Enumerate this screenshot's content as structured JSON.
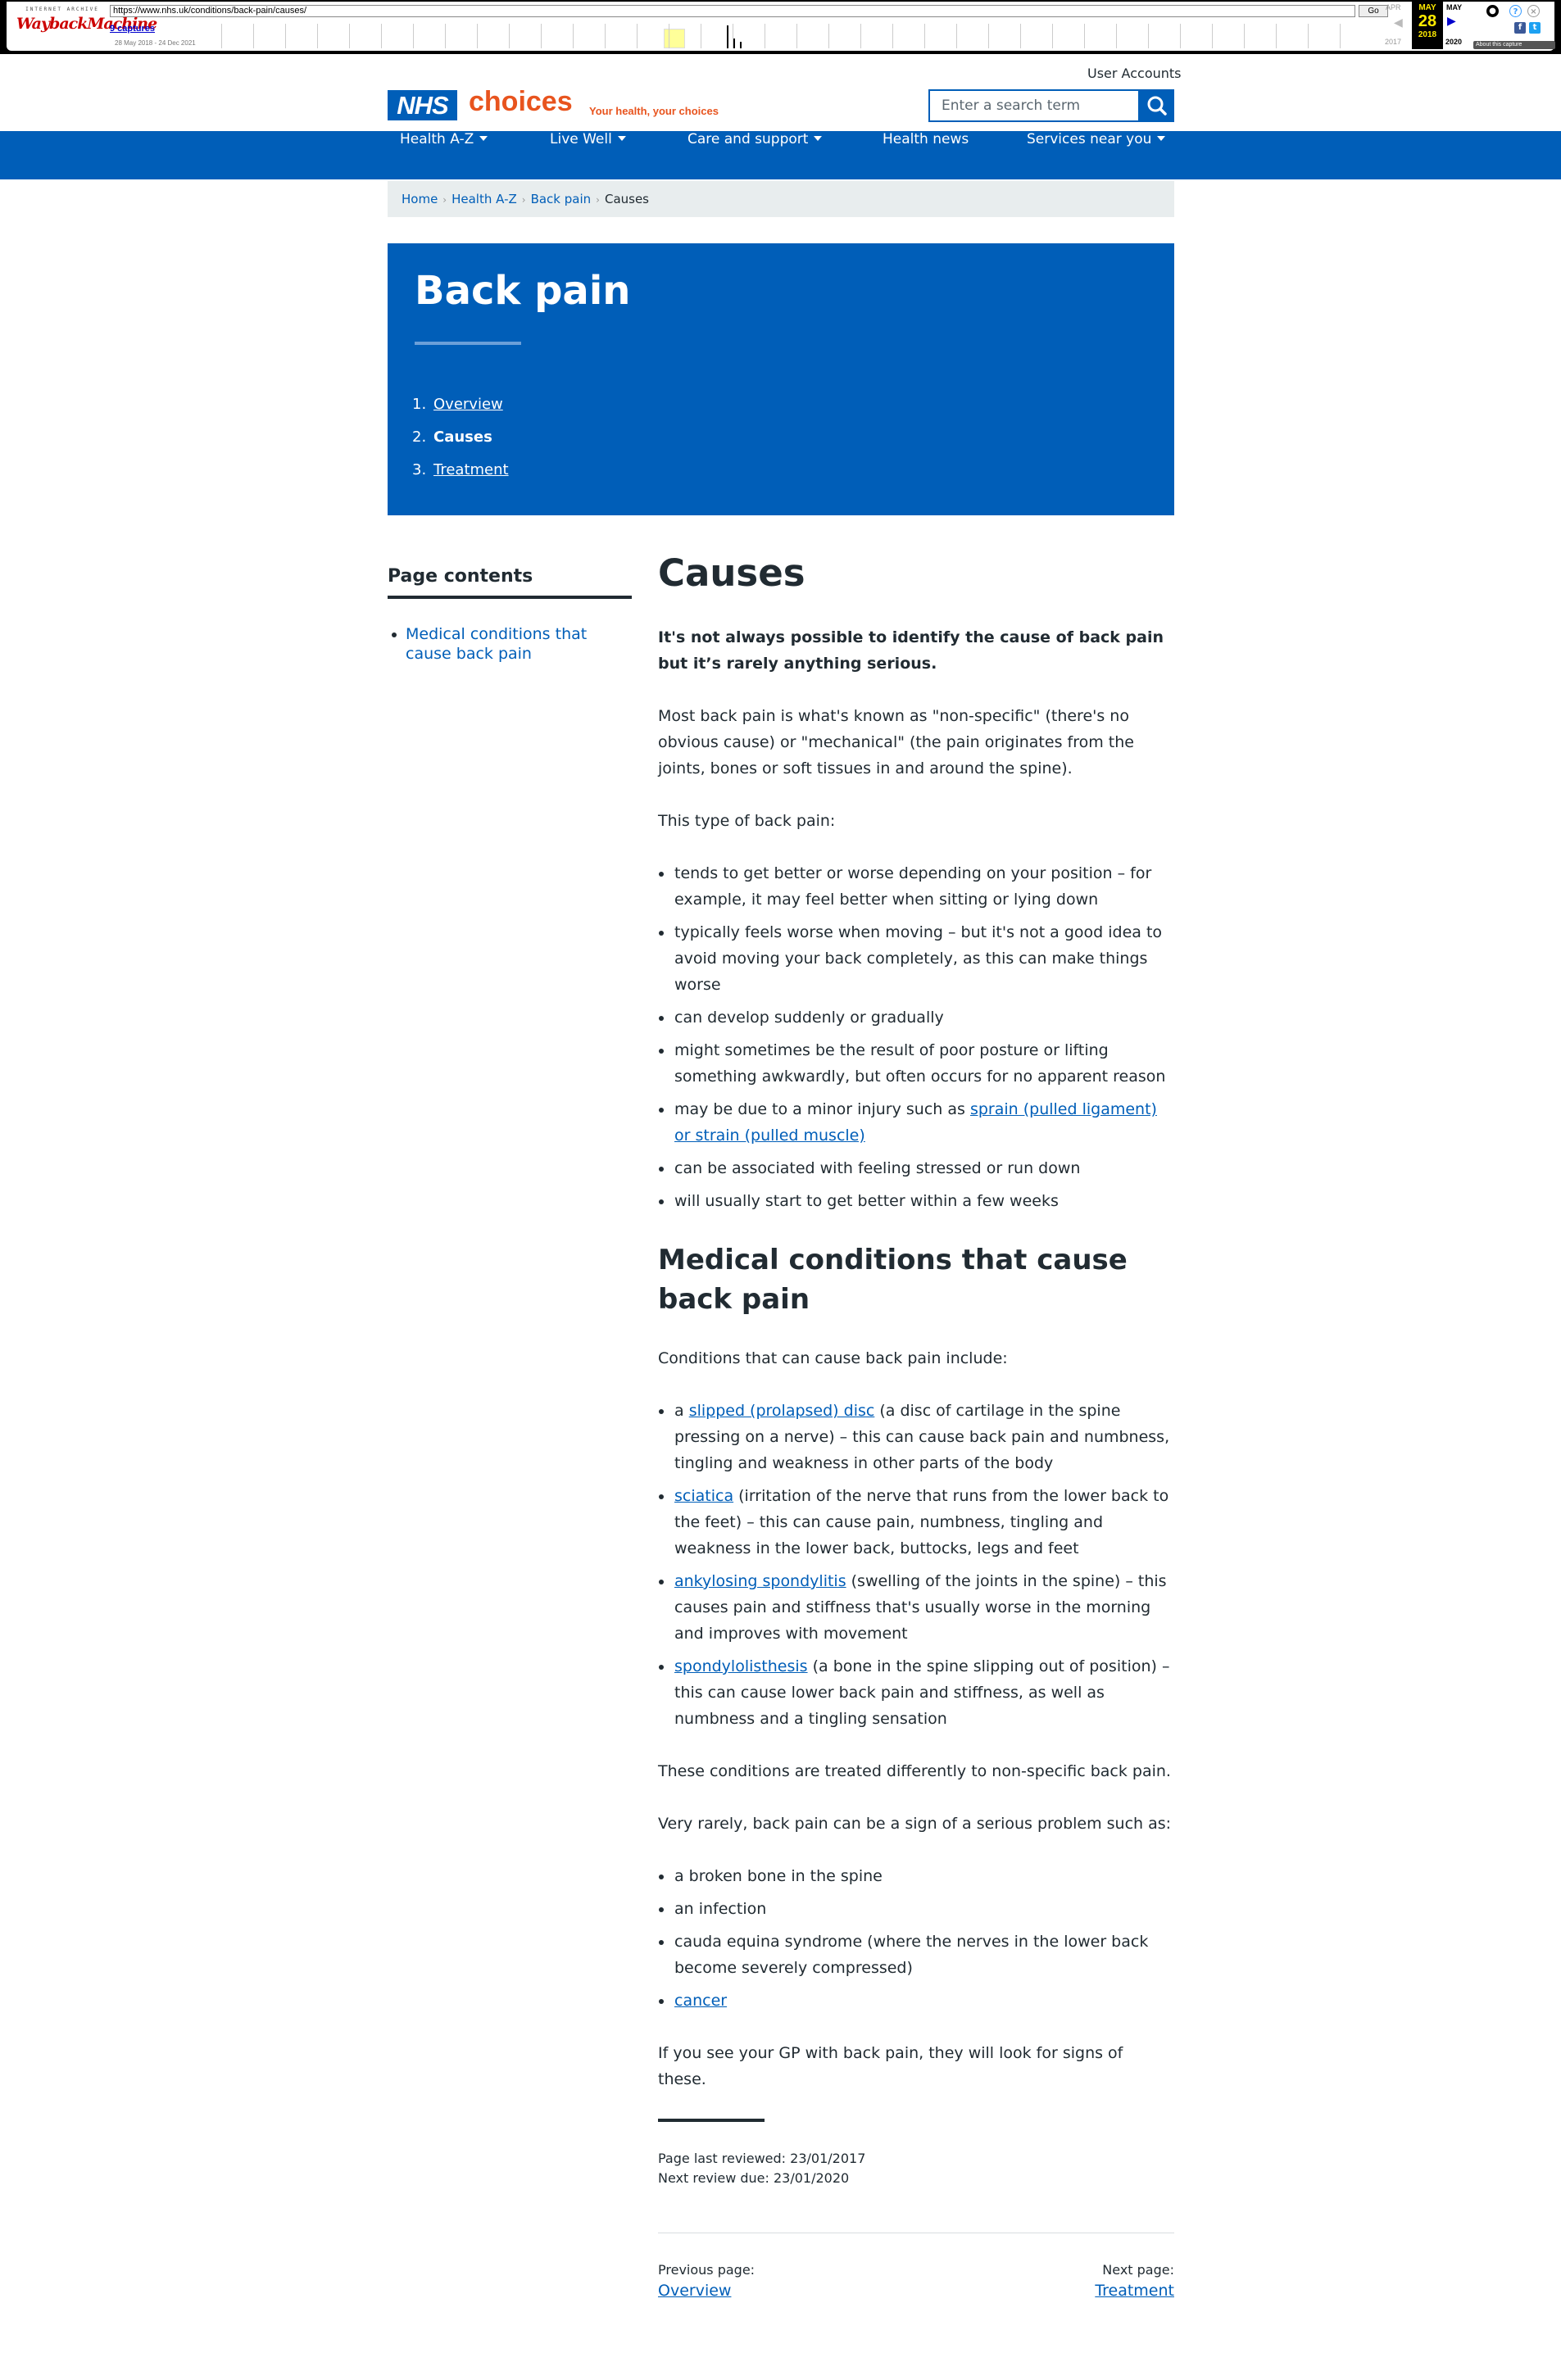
{
  "wayback": {
    "logo_top": "INTERNET ARCHIVE",
    "logo_main": "WaybackMachine",
    "url": "https://www.nhs.uk/conditions/back-pain/causes/",
    "go_label": "Go",
    "captures": "9 captures",
    "date_range": "28 May 2018 - 24 Dec 2021",
    "prev_month": "APR",
    "cur_month": "MAY",
    "next_month": "MAY",
    "day": "28",
    "prev_year": "2017",
    "cur_year": "2018",
    "next_year": "2020",
    "about": "About this capture"
  },
  "header": {
    "user_accounts": "User Accounts",
    "logo_nhs": "NHS",
    "logo_choices": "choices",
    "logo_tagline": "Your health, your choices",
    "search_placeholder": "Enter a search term"
  },
  "nav": [
    "Health A-Z",
    "Live Well",
    "Care and support",
    "Health news",
    "Services near you"
  ],
  "breadcrumb": [
    "Home",
    "Health A-Z",
    "Back pain",
    "Causes"
  ],
  "hero": {
    "title": "Back pain",
    "items": [
      {
        "num": "1.",
        "label": "Overview"
      },
      {
        "num": "2.",
        "label": "Causes"
      },
      {
        "num": "3.",
        "label": "Treatment"
      }
    ]
  },
  "sidebar": {
    "title": "Page contents",
    "items": [
      "Medical conditions that cause back pain"
    ]
  },
  "main": {
    "h1": "Causes",
    "lead": "It's not always possible to identify the cause of back pain but it’s rarely anything serious.",
    "p1": "Most back pain is what's known as \"non-specific\" (there's no obvious cause) or \"mechanical\" (the pain originates from the joints, bones or soft tissues in and around the spine).",
    "p2": "This type of back pain:",
    "list1": [
      "tends to get better or worse depending on your position – for example, it may feel better when sitting or lying down",
      "typically feels worse when moving – but it's not a good idea to avoid moving your back completely, as this can make things worse",
      "can develop suddenly or gradually",
      "might sometimes be the result of poor posture or lifting something awkwardly, but often occurs for no apparent reason"
    ],
    "list1_minor_pre": "may be due to a minor injury such as ",
    "list1_minor_link": "sprain (pulled ligament) or strain (pulled muscle)",
    "list1b": [
      "can be associated with feeling stressed or run down",
      "will usually start to get better within a few weeks"
    ],
    "h2": "Medical conditions that cause back pain",
    "p3": "Conditions that can cause back pain include:",
    "cond": [
      {
        "pre": "a ",
        "link": "slipped (prolapsed) disc",
        "post": " (a disc of cartilage in the spine pressing on a nerve) – this can cause back pain and numbness, tingling and weakness in other parts of the body"
      },
      {
        "pre": "",
        "link": "sciatica",
        "post": " (irritation of the nerve that runs from the lower back to the feet) – this can cause pain, numbness, tingling and weakness in the lower back, buttocks, legs and feet"
      },
      {
        "pre": "",
        "link": "ankylosing spondylitis",
        "post": " (swelling of the joints in the spine) – this causes pain and stiffness that's usually worse in the morning and improves with movement"
      },
      {
        "pre": "",
        "link": "spondylolisthesis",
        "post": " (a bone in the spine slipping out of position) – this can cause lower back pain and stiffness, as well as numbness and a tingling sensation"
      }
    ],
    "p4": "These conditions are treated differently to non-specific back pain.",
    "p5": "Very rarely, back pain can be a sign of a serious problem such as:",
    "list3": [
      "a broken bone in the spine",
      "an infection",
      "cauda equina syndrome (where the nerves in the lower back become severely compressed)"
    ],
    "list3_link": "cancer",
    "p6": "If you see your GP with back pain, they will look for signs of these.",
    "reviewed": "Page last reviewed: 23/01/2017",
    "next_review": "Next review due: 23/01/2020"
  },
  "pager": {
    "prev_label": "Previous page:",
    "prev_link": "Overview",
    "next_label": "Next page:",
    "next_link": "Treatment"
  }
}
